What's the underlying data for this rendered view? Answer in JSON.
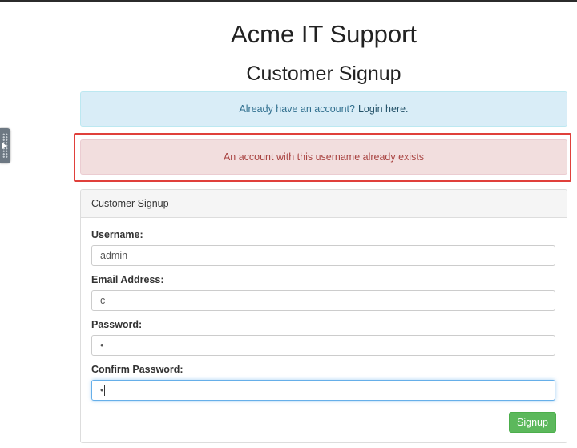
{
  "app": {
    "title": "Acme IT Support"
  },
  "page": {
    "title": "Customer Signup"
  },
  "info_alert": {
    "text": "Already have an account?",
    "link_label": "Login here."
  },
  "error_alert": {
    "text": "An account with this username already exists"
  },
  "form": {
    "panel_heading": "Customer Signup",
    "fields": [
      {
        "label": "Username:",
        "value": "admin"
      },
      {
        "label": "Email Address:",
        "value": "c"
      },
      {
        "label": "Password:",
        "value": "•"
      },
      {
        "label": "Confirm Password:",
        "value": "•"
      }
    ],
    "submit_label": "Signup"
  },
  "colors": {
    "info_bg": "#d9edf7",
    "error_bg": "#f2dede",
    "highlight_border": "#e0403b",
    "success_button": "#5cb85c"
  }
}
